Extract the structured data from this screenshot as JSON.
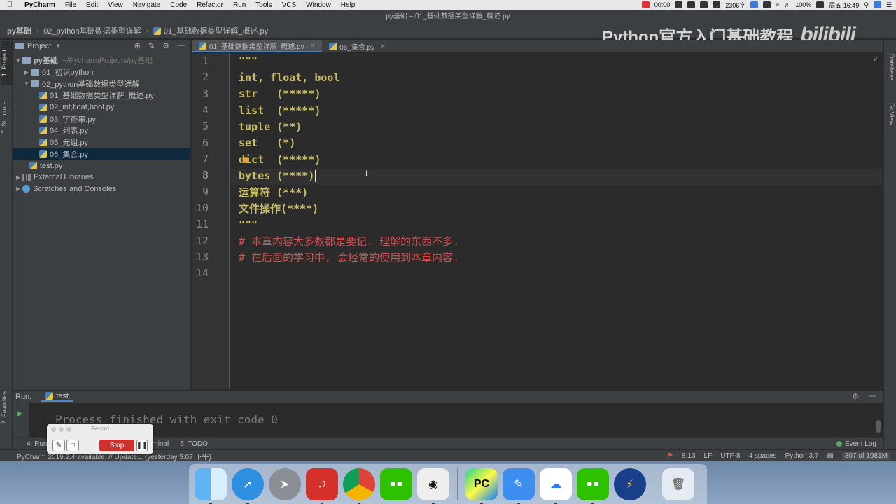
{
  "menubar": {
    "items": [
      "PyCharm",
      "File",
      "Edit",
      "View",
      "Navigate",
      "Code",
      "Refactor",
      "Run",
      "Tools",
      "VCS",
      "Window",
      "Help"
    ],
    "tray_timer": "00:00",
    "tray_chars": "2306字",
    "battery": "100%",
    "clock": "周五 16:49"
  },
  "window": {
    "title": "py基础 – 01_基础数据类型详解_概述.py"
  },
  "breadcrumbs": [
    "py基础",
    "02_python基础数据类型详解",
    "01_基础数据类型详解_概述.py"
  ],
  "watermark": {
    "text": "Python官方入门基础教程",
    "logo": "bilibili"
  },
  "left_stripe": {
    "project_tab": "1: Project",
    "structure_tab": "7: Structure",
    "favorites_tab": "2: Favorites"
  },
  "right_stripe": {
    "database_tab": "Database",
    "sciview_tab": "SciView"
  },
  "project": {
    "header": "Project",
    "root_name": "py基础",
    "root_path": "~/PycharmProjects/py基础",
    "folder1": "01_初识python",
    "folder2": "02_python基础数据类型详解",
    "files": [
      "01_基础数据类型详解_概述.py",
      "02_int,float,bool.py",
      "03_字符串.py",
      "04_列表.py",
      "05_元组.py",
      "06_集合.py"
    ],
    "testfile": "test.py",
    "external": "External Libraries",
    "scratches": "Scratches and Consoles"
  },
  "editor": {
    "tabs": [
      "01_基础数据类型详解_概述.py",
      "06_集合.py"
    ],
    "line_numbers": [
      "1",
      "2",
      "3",
      "4",
      "5",
      "6",
      "7",
      "8",
      "9",
      "10",
      "11",
      "12",
      "13",
      "14"
    ],
    "lines": [
      "\"\"\"",
      "int, float, bool",
      "str   (*****)",
      "list  (*****)",
      "tuple (**)",
      "set   (*)",
      "dict  (*****)",
      "bytes (****)",
      "运算符 (***)",
      "文件操作(****)",
      "\"\"\"",
      "# 本章内容大多数都是要记. 理解的东西不多.",
      "# 在后面的学习中, 会经常的使用到本章内容.",
      ""
    ]
  },
  "run": {
    "title": "Run:",
    "tab": "test",
    "output": "Process finished with exit code 0"
  },
  "bottom_tabs": {
    "run": "4: Run",
    "terminal": "Terminal",
    "todo": "6: TODO",
    "event_log": "Event Log"
  },
  "record_widget": {
    "title": "Record",
    "stop": "Stop"
  },
  "status": {
    "message": "PyCharm 2019.2.4 available: // Update... (yesterday 5:07 下午)",
    "position": "8:13",
    "line_sep": "LF",
    "encoding": "UTF-8",
    "indent": "4 spaces",
    "interpreter": "Python 3.7",
    "memory": "307 of 1981M"
  },
  "colors": {
    "keyword_yellow": "#cbbe6a",
    "comment_red": "#d05252",
    "bg": "#2b2b2b",
    "panel": "#3c3f41"
  },
  "dock_apps": [
    "finder-icon",
    "safari-icon",
    "launchpad-icon",
    "netease-music-icon",
    "chrome-icon",
    "wechat-icon",
    "qq-icon",
    "pycharm-icon",
    "paw-icon",
    "baidu-netdisk-icon",
    "wechat-work-icon",
    "instastats-icon",
    "trash-icon"
  ]
}
